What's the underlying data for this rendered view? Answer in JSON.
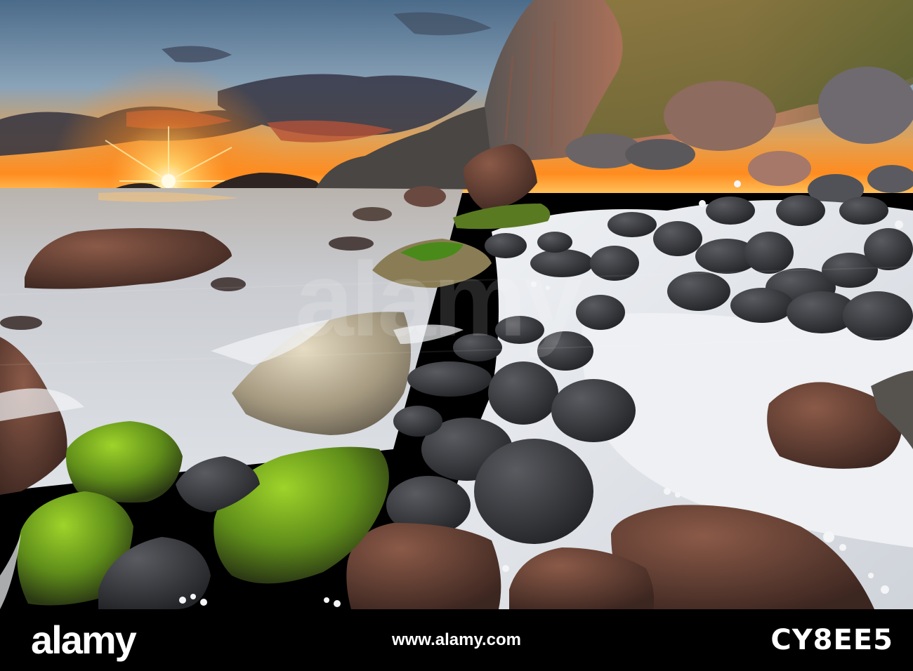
{
  "photo": {
    "scene": "coastal-sunset",
    "palette": {
      "sky_top": "#4f6f8c",
      "sky_mid": "#d9a35a",
      "sun": "#fff4c2",
      "horizon": "#ff8a1c",
      "sea": "#c9cfd6",
      "cliff_lit": "#b86a4c",
      "cliff_shadow": "#4a4744",
      "grass": "#6a7a3a",
      "boulder_dark": "#3a3b3f",
      "boulder_brown": "#6e4438",
      "moss": "#7ab31f",
      "chalk": "#e8eaee"
    }
  },
  "stock_bar": {
    "logo": "alamy",
    "host": "www.alamy.com",
    "image_id": "CY8EE5"
  }
}
